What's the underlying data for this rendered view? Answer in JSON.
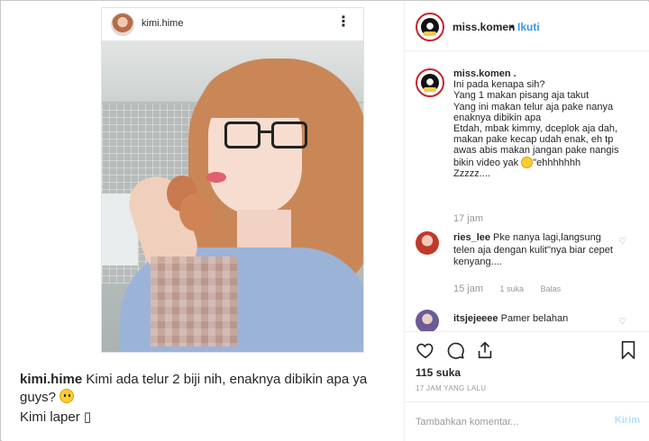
{
  "embedded_post": {
    "username": "kimi.hime",
    "menu_icon": "more-vertical-icon"
  },
  "caption": {
    "username": "kimi.hime",
    "text": " Kimi ada telur 2 biji nih, enaknya dibikin apa ya guys?",
    "line2": "Kimi laper",
    "line2_glyph": "▯"
  },
  "header": {
    "username": "miss.komen",
    "separator": "•",
    "follow_label": "Ikuti"
  },
  "main_comment": {
    "username": "miss.komen .",
    "lines": [
      "Ini pada kenapa sih?",
      "Yang 1 makan pisang aja takut",
      "Yang ini makan telur aja pake nanya",
      "enaknya dibikin apa",
      "Etdah, mbak kimmy, dceplok aja dah,",
      "makan pake kecap udah enak, eh tp",
      "awas abis makan jangan pake nangis"
    ],
    "last_before_emoji": "bikin video yak ",
    "last_after_emoji": "\"ehhhhhhh",
    "end": "Zzzzz....",
    "time": "17 jam"
  },
  "replies": [
    {
      "username": "ries_lee",
      "text": " Pke nanya lagi,langsung telen aja dengan kulit\"nya biar cepet kenyang....",
      "time": "15 jam",
      "likes": "1 suka",
      "reply_label": "Balas"
    },
    {
      "username": "itsjejeeee",
      "text": " Pamer belahan"
    }
  ],
  "actions": {
    "likes": "115 suka",
    "timestamp": "17 JAM YANG LALU"
  },
  "add_comment": {
    "placeholder": "Tambahkan komentar...",
    "post_label": "Kirim"
  }
}
